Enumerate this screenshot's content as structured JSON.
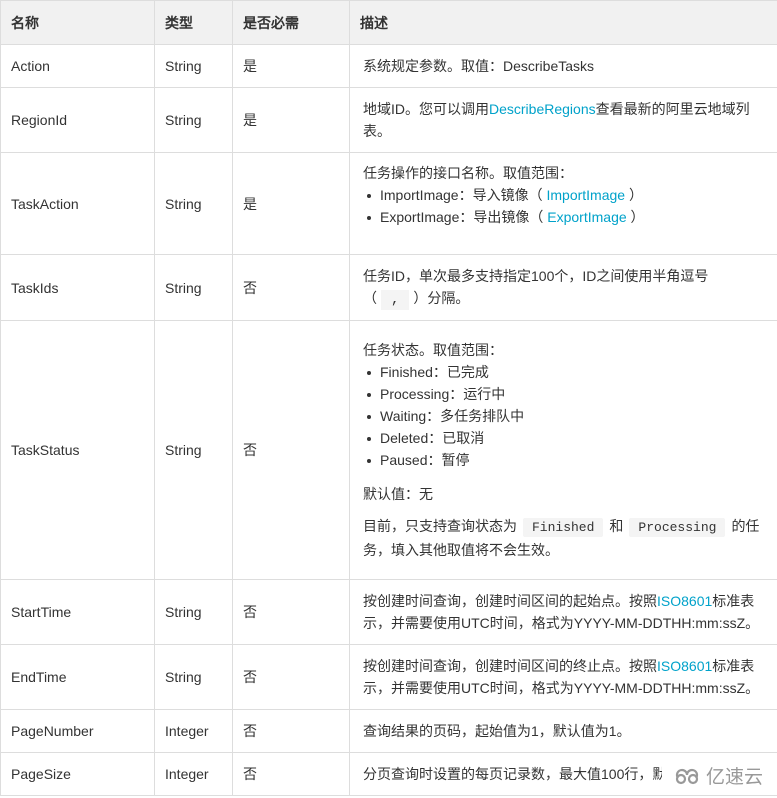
{
  "table": {
    "headers": [
      "名称",
      "类型",
      "是否必需",
      "描述"
    ],
    "rows": [
      {
        "name": "Action",
        "type": "String",
        "required": "是",
        "desc": {
          "pre": "系统规定参数。取值：DescribeTasks"
        }
      },
      {
        "name": "RegionId",
        "type": "String",
        "required": "是",
        "desc": {
          "pre": "地域ID。您可以调用",
          "link": "DescribeRegions",
          "post": "查看最新的阿里云地域列表。"
        }
      },
      {
        "name": "TaskAction",
        "type": "String",
        "required": "是",
        "desc": {
          "intro": "任务操作的接口名称。取值范围：",
          "items": [
            {
              "text": "ImportImage：导入镜像（",
              "link": "ImportImage",
              "post": "）"
            },
            {
              "text": "ExportImage：导出镜像（",
              "link": "ExportImage",
              "post": "）"
            }
          ]
        }
      },
      {
        "name": "TaskIds",
        "type": "String",
        "required": "否",
        "desc": {
          "pre": "任务ID，单次最多支持指定100个，ID之间使用半角逗号",
          "open": "（",
          "code": ",",
          "post": "）分隔。"
        }
      },
      {
        "name": "TaskStatus",
        "type": "String",
        "required": "否",
        "desc": {
          "intro": "任务状态。取值范围：",
          "items": [
            "Finished：已完成",
            "Processing：运行中",
            "Waiting：多任务排队中",
            "Deleted：已取消",
            "Paused：暂停"
          ],
          "default": "默认值：无",
          "note_pre": "目前，只支持查询状态为",
          "code1": "Finished",
          "note_mid": "和",
          "code2": "Processing",
          "note_post": "的任务，填入其他取值将不会生效。"
        }
      },
      {
        "name": "StartTime",
        "type": "String",
        "required": "否",
        "desc": {
          "pre": "按创建时间查询，创建时间区间的起始点。按照",
          "link": "ISO8601",
          "post": "标准表示，并需要使用UTC时间，格式为YYYY-MM-DDTHH:mm:ssZ。"
        }
      },
      {
        "name": "EndTime",
        "type": "String",
        "required": "否",
        "desc": {
          "pre": "按创建时间查询，创建时间区间的终止点。按照",
          "link": "ISO8601",
          "post": "标准表示，并需要使用UTC时间，格式为YYYY-MM-DDTHH:mm:ssZ。"
        }
      },
      {
        "name": "PageNumber",
        "type": "Integer",
        "required": "否",
        "desc": {
          "pre": "查询结果的页码，起始值为1，默认值为1。"
        }
      },
      {
        "name": "PageSize",
        "type": "Integer",
        "required": "否",
        "desc": {
          "pre": "分页查询时设置的每页记录数，最大值100行，默认"
        }
      }
    ]
  },
  "watermark": {
    "icon": "cloud-logo-icon",
    "text": "亿速云"
  },
  "colors": {
    "link": "#00a2ca",
    "header_bg": "#f1f1f1",
    "border": "#dddddd"
  }
}
